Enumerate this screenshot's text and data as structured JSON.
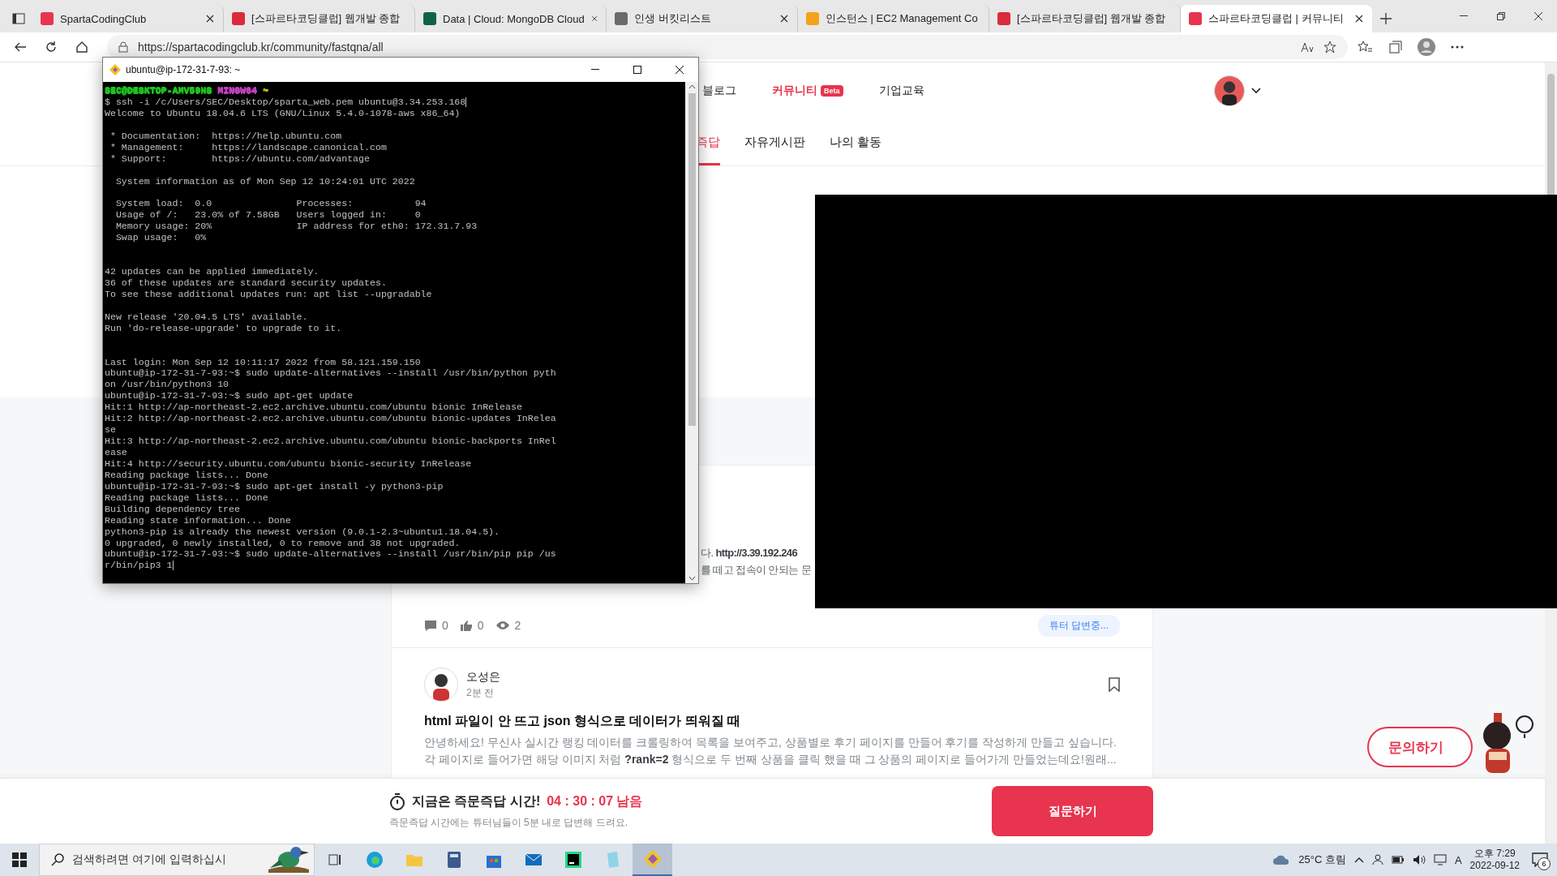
{
  "browser": {
    "tabs": [
      {
        "title": "SpartaCodingClub",
        "selected": false,
        "color": "#e8344e"
      },
      {
        "title": "[스파르타코딩클럽] 웹개발 종합",
        "selected": false,
        "color": "#d92b3a"
      },
      {
        "title": "Data | Cloud: MongoDB Cloud",
        "selected": false,
        "color": "#116149"
      },
      {
        "title": "인생 버킷리스트",
        "selected": false,
        "color": "#6b6b6b"
      },
      {
        "title": "인스턴스 | EC2 Management Co",
        "selected": false,
        "color": "#f3a31b"
      },
      {
        "title": "[스파르타코딩클럽] 웹개발 종합",
        "selected": false,
        "color": "#d92b3a"
      },
      {
        "title": "스파르타코딩클럽 | 커뮤니티",
        "selected": true,
        "color": "#e8344e"
      }
    ],
    "address": "https://spartacodingclub.kr/community/fastqna/all"
  },
  "site": {
    "nav": [
      {
        "label": "블로그",
        "selected": false
      },
      {
        "label": "커뮤니티",
        "selected": true,
        "badge": "Beta"
      },
      {
        "label": "기업교육",
        "selected": false
      }
    ],
    "tabs": [
      {
        "label": "즉답",
        "selected": true
      },
      {
        "label": "자유게시판",
        "selected": false
      },
      {
        "label": "나의 활동",
        "selected": false
      }
    ],
    "first_post": {
      "excerpt_lines": [
        "다. **http://3.39.192.246**",
        "를 떼고 접속이 안되는 문"
      ],
      "comments": "0",
      "likes": "0",
      "views": "2",
      "status": "튜터 답변중..."
    },
    "second_post": {
      "author": "오성은",
      "time": "2분 전",
      "bookmarked": false,
      "title": "html 파일이 안 뜨고 json 형식으로 데이터가 띄워질 때",
      "excerpt_lines": [
        "안녕하세요! 무신사 실시간 랭킹 데이터를 크롤링하여 목록을 보여주고, 상품별로 후기 페이지를 만들어 후기를 작성하게 만들고 싶습니다.",
        "각 페이지로 들어가면 해당 이미지 처럼 **?rank=2** 형식으로 두 번째 상품을 클릭 했을 때 그 상품의 페이지로 들어가게 만들었는데요!원래..."
      ]
    },
    "inquiry_button": "문의하기",
    "bottom_bar": {
      "headline": "지금은 즉문즉답 시간!",
      "countdown": "04 : 30 : 07 남음",
      "note": "즉문즉답 시간에는 튜터님들이 5분 내로 답변해 드려요.",
      "button": "질문하기"
    }
  },
  "terminal": {
    "title": "ubuntu@ip-172-31-7-93: ~",
    "lines": [
      {
        "kind": "prompt",
        "segments": [
          {
            "text": "SEC@DESKTOP-AMV59HS",
            "color": "#20c020"
          },
          {
            "text": "MINGW64",
            "color": "#c040c0"
          },
          {
            "text": "~",
            "color": "#c0c000"
          }
        ]
      },
      {
        "kind": "text",
        "text": "$ ssh -i /c/Users/SEC/Desktop/sparta_web.pem ubuntu@3.34.253.168",
        "cursor": true
      },
      {
        "kind": "text",
        "text": "Welcome to Ubuntu 18.04.6 LTS (GNU/Linux 5.4.0-1078-aws x86_64)"
      },
      {
        "kind": "blank"
      },
      {
        "kind": "text",
        "text": " * Documentation:  https://help.ubuntu.com"
      },
      {
        "kind": "text",
        "text": " * Management:     https://landscape.canonical.com"
      },
      {
        "kind": "text",
        "text": " * Support:        https://ubuntu.com/advantage"
      },
      {
        "kind": "blank"
      },
      {
        "kind": "text",
        "text": "  System information as of Mon Sep 12 10:24:01 UTC 2022"
      },
      {
        "kind": "blank"
      },
      {
        "kind": "text",
        "text": "  System load:  0.0               Processes:           94"
      },
      {
        "kind": "text",
        "text": "  Usage of /:   23.0% of 7.58GB   Users logged in:     0"
      },
      {
        "kind": "text",
        "text": "  Memory usage: 20%               IP address for eth0: 172.31.7.93"
      },
      {
        "kind": "text",
        "text": "  Swap usage:   0%"
      },
      {
        "kind": "blank"
      },
      {
        "kind": "blank"
      },
      {
        "kind": "text",
        "text": "42 updates can be applied immediately."
      },
      {
        "kind": "text",
        "text": "36 of these updates are standard security updates."
      },
      {
        "kind": "text",
        "text": "To see these additional updates run: apt list --upgradable"
      },
      {
        "kind": "blank"
      },
      {
        "kind": "text",
        "text": "New release '20.04.5 LTS' available."
      },
      {
        "kind": "text",
        "text": "Run 'do-release-upgrade' to upgrade to it."
      },
      {
        "kind": "blank"
      },
      {
        "kind": "blank"
      },
      {
        "kind": "text",
        "text": "Last login: Mon Sep 12 10:11:17 2022 from 58.121.159.150"
      },
      {
        "kind": "text",
        "text": "ubuntu@ip-172-31-7-93:~$ sudo update-alternatives --install /usr/bin/python pyth"
      },
      {
        "kind": "text",
        "text": "on /usr/bin/python3 10"
      },
      {
        "kind": "text",
        "text": "ubuntu@ip-172-31-7-93:~$ sudo apt-get update"
      },
      {
        "kind": "text",
        "text": "Hit:1 http://ap-northeast-2.ec2.archive.ubuntu.com/ubuntu bionic InRelease"
      },
      {
        "kind": "text",
        "text": "Hit:2 http://ap-northeast-2.ec2.archive.ubuntu.com/ubuntu bionic-updates InRelea"
      },
      {
        "kind": "text",
        "text": "se"
      },
      {
        "kind": "text",
        "text": "Hit:3 http://ap-northeast-2.ec2.archive.ubuntu.com/ubuntu bionic-backports InRel"
      },
      {
        "kind": "text",
        "text": "ease"
      },
      {
        "kind": "text",
        "text": "Hit:4 http://security.ubuntu.com/ubuntu bionic-security InRelease"
      },
      {
        "kind": "text",
        "text": "Reading package lists... Done"
      },
      {
        "kind": "text",
        "text": "ubuntu@ip-172-31-7-93:~$ sudo apt-get install -y python3-pip"
      },
      {
        "kind": "text",
        "text": "Reading package lists... Done"
      },
      {
        "kind": "text",
        "text": "Building dependency tree"
      },
      {
        "kind": "text",
        "text": "Reading state information... Done"
      },
      {
        "kind": "text",
        "text": "python3-pip is already the newest version (9.0.1-2.3~ubuntu1.18.04.5)."
      },
      {
        "kind": "text",
        "text": "0 upgraded, 0 newly installed, 0 to remove and 38 not upgraded."
      },
      {
        "kind": "text",
        "text": "ubuntu@ip-172-31-7-93:~$ sudo update-alternatives --install /usr/bin/pip pip /us"
      },
      {
        "kind": "text",
        "text": "r/bin/pip3 1",
        "cursor": true
      }
    ]
  },
  "taskbar": {
    "search_placeholder": "검색하려면 여기에 입력하십시",
    "apps": [
      {
        "kind": "taskview",
        "selected": false
      },
      {
        "kind": "browser",
        "selected": false
      },
      {
        "kind": "folder",
        "selected": false
      },
      {
        "kind": "calculator",
        "selected": false
      },
      {
        "kind": "store",
        "selected": false
      },
      {
        "kind": "mail",
        "selected": false
      },
      {
        "kind": "ide",
        "selected": false
      },
      {
        "kind": "notepad",
        "selected": false
      },
      {
        "kind": "gitbash",
        "selected": true
      }
    ],
    "weather": "25°C 흐림",
    "ime": "A",
    "time": "오후 7:29",
    "date": "2022-09-12",
    "notifications": "6"
  }
}
